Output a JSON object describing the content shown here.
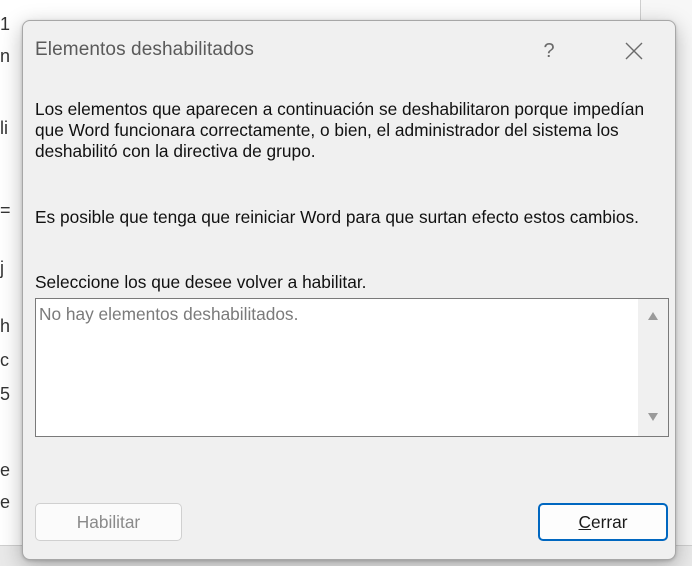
{
  "background": {
    "left_glyphs": [
      "1",
      "n",
      "li",
      "=",
      "j",
      "h",
      "c",
      "5",
      "e",
      "e"
    ]
  },
  "dialog": {
    "title": "Elementos deshabilitados",
    "help_label": "?",
    "paragraph_1": "Los elementos que aparecen a continuación se deshabilitaron porque impedían que Word funcionara correctamente, o bien, el administrador del sistema los deshabilitó con la directiva de grupo.",
    "paragraph_2": "Es posible que tenga que reiniciar Word para que surtan efecto estos cambios.",
    "paragraph_3": "Seleccione los que desee volver a habilitar.",
    "list": {
      "empty_text": "No hay elementos deshabilitados."
    },
    "buttons": {
      "enable_label": "Habilitar",
      "close_label_mnemonic": "C",
      "close_label_rest": "errar"
    }
  },
  "colors": {
    "accent_border": "#0067c0",
    "dialog_bg": "#f0f0f0",
    "disabled_text": "#8a8a8a"
  },
  "icons": {
    "help": "question-mark",
    "close": "close-icon",
    "scroll_up": "triangle-up-icon",
    "scroll_down": "triangle-down-icon"
  }
}
